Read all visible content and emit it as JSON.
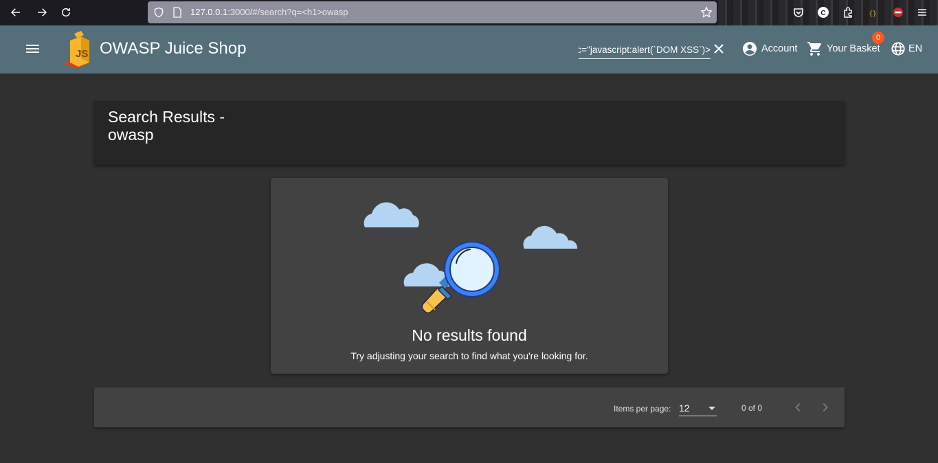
{
  "browser": {
    "url_host": "127.0.0.1",
    "url_rest": ":3000/#/search?q=<h1>owasp",
    "icons": [
      "back-icon",
      "forward-icon",
      "reload-icon",
      "shield-icon",
      "page-icon",
      "star-icon",
      "pocket-icon",
      "extension-icon",
      "menu-icon"
    ]
  },
  "app": {
    "title": "OWASP Juice Shop",
    "search_value": "<iframe src=\"javascript:alert(`DOM XSS`)\">",
    "account_label": "Account",
    "basket_label": "Your Basket",
    "basket_count": "0",
    "language_label": "EN"
  },
  "results": {
    "heading": "Search Results - owasp",
    "empty_title": "No results found",
    "empty_subtitle": "Try adjusting your search to find what you're looking for."
  },
  "paginator": {
    "items_per_page_label": "Items per page:",
    "items_per_page_value": "12",
    "range_label": "0 of 0"
  },
  "colors": {
    "toolbar": "#546e7a",
    "background": "#303030",
    "card": "#424242",
    "badge": "#ff5722"
  }
}
